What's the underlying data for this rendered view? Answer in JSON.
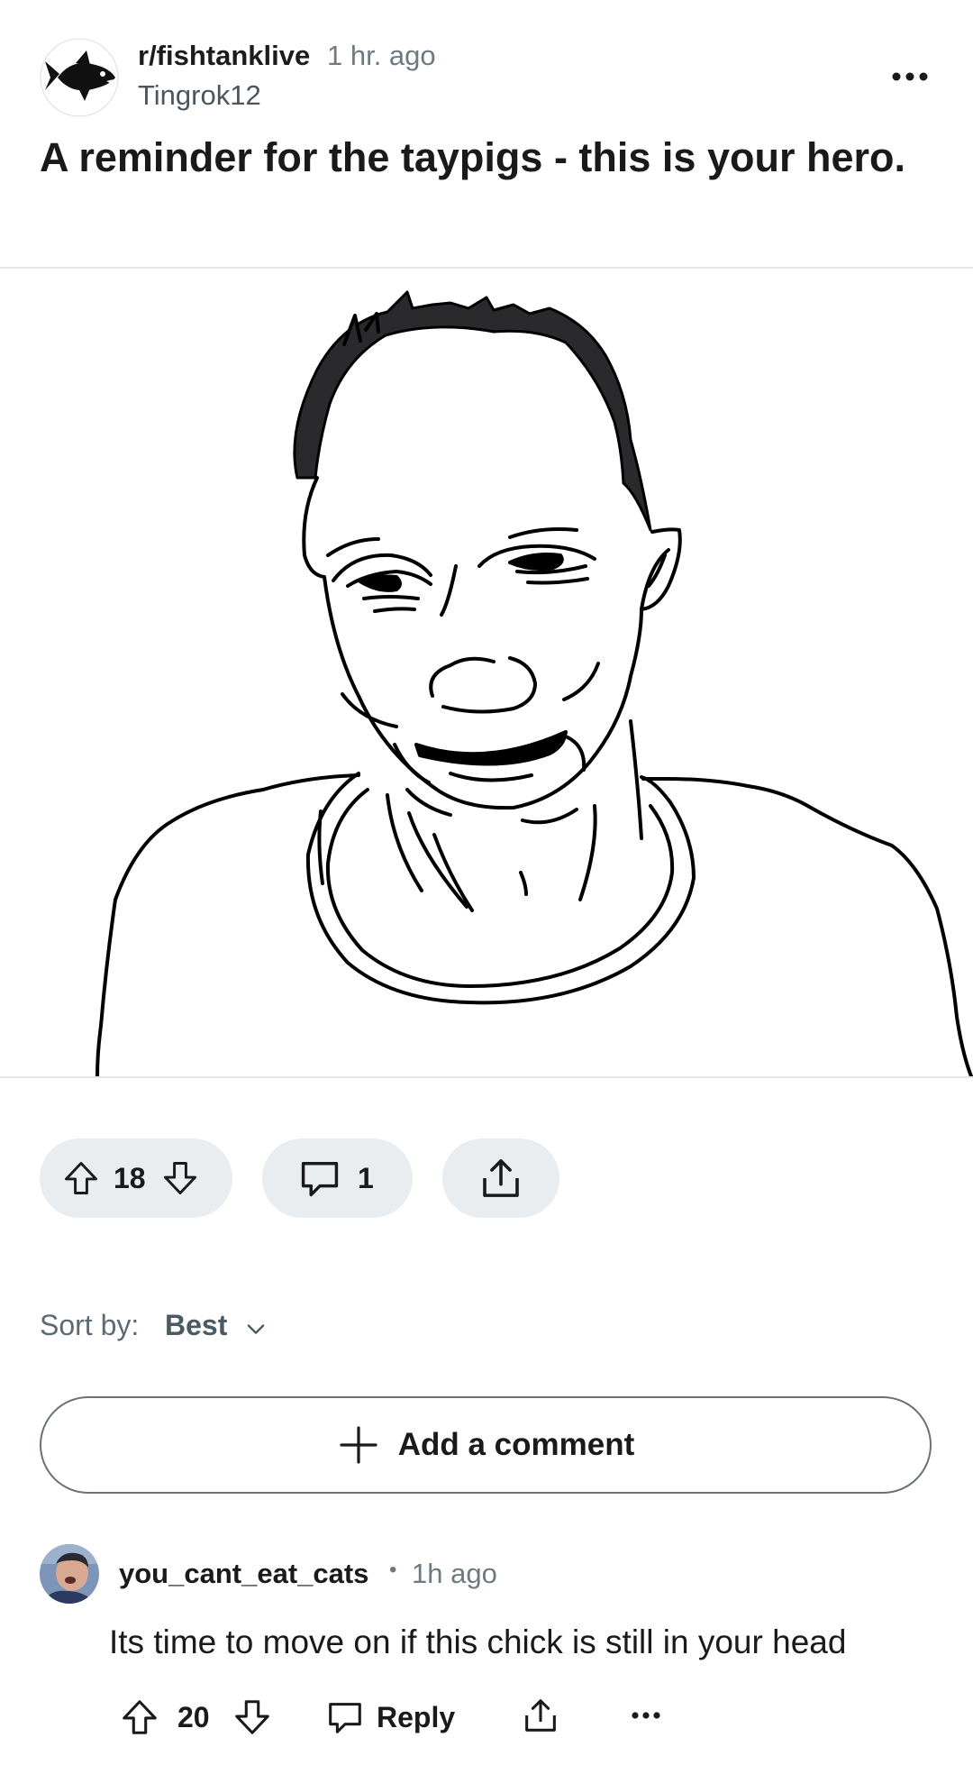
{
  "post": {
    "subreddit": "r/fishtanklive",
    "time": "1 hr. ago",
    "author": "Tingrok12",
    "title": "A reminder for the taypigs - this is your hero."
  },
  "actions": {
    "votes": "18",
    "comments": "1"
  },
  "sort": {
    "label": "Sort by:",
    "value": "Best"
  },
  "add_comment": {
    "label": "Add a comment"
  },
  "comment": {
    "author": "you_cant_eat_cats",
    "separator": "•",
    "time": "1h ago",
    "body": "Its time to move on if this chick is still in your head",
    "score": "20",
    "reply_label": "Reply"
  },
  "icons": {
    "overflow": "more-horizontal-icon",
    "upvote": "arrow-up-icon",
    "downvote": "arrow-down-icon",
    "comment": "speech-bubble-icon",
    "share": "share-icon",
    "chevron": "chevron-down-icon",
    "plus": "plus-icon"
  },
  "colors": {
    "pill_bg": "#eaedef",
    "muted_text": "#6d7a80",
    "border": "#6a7075"
  }
}
